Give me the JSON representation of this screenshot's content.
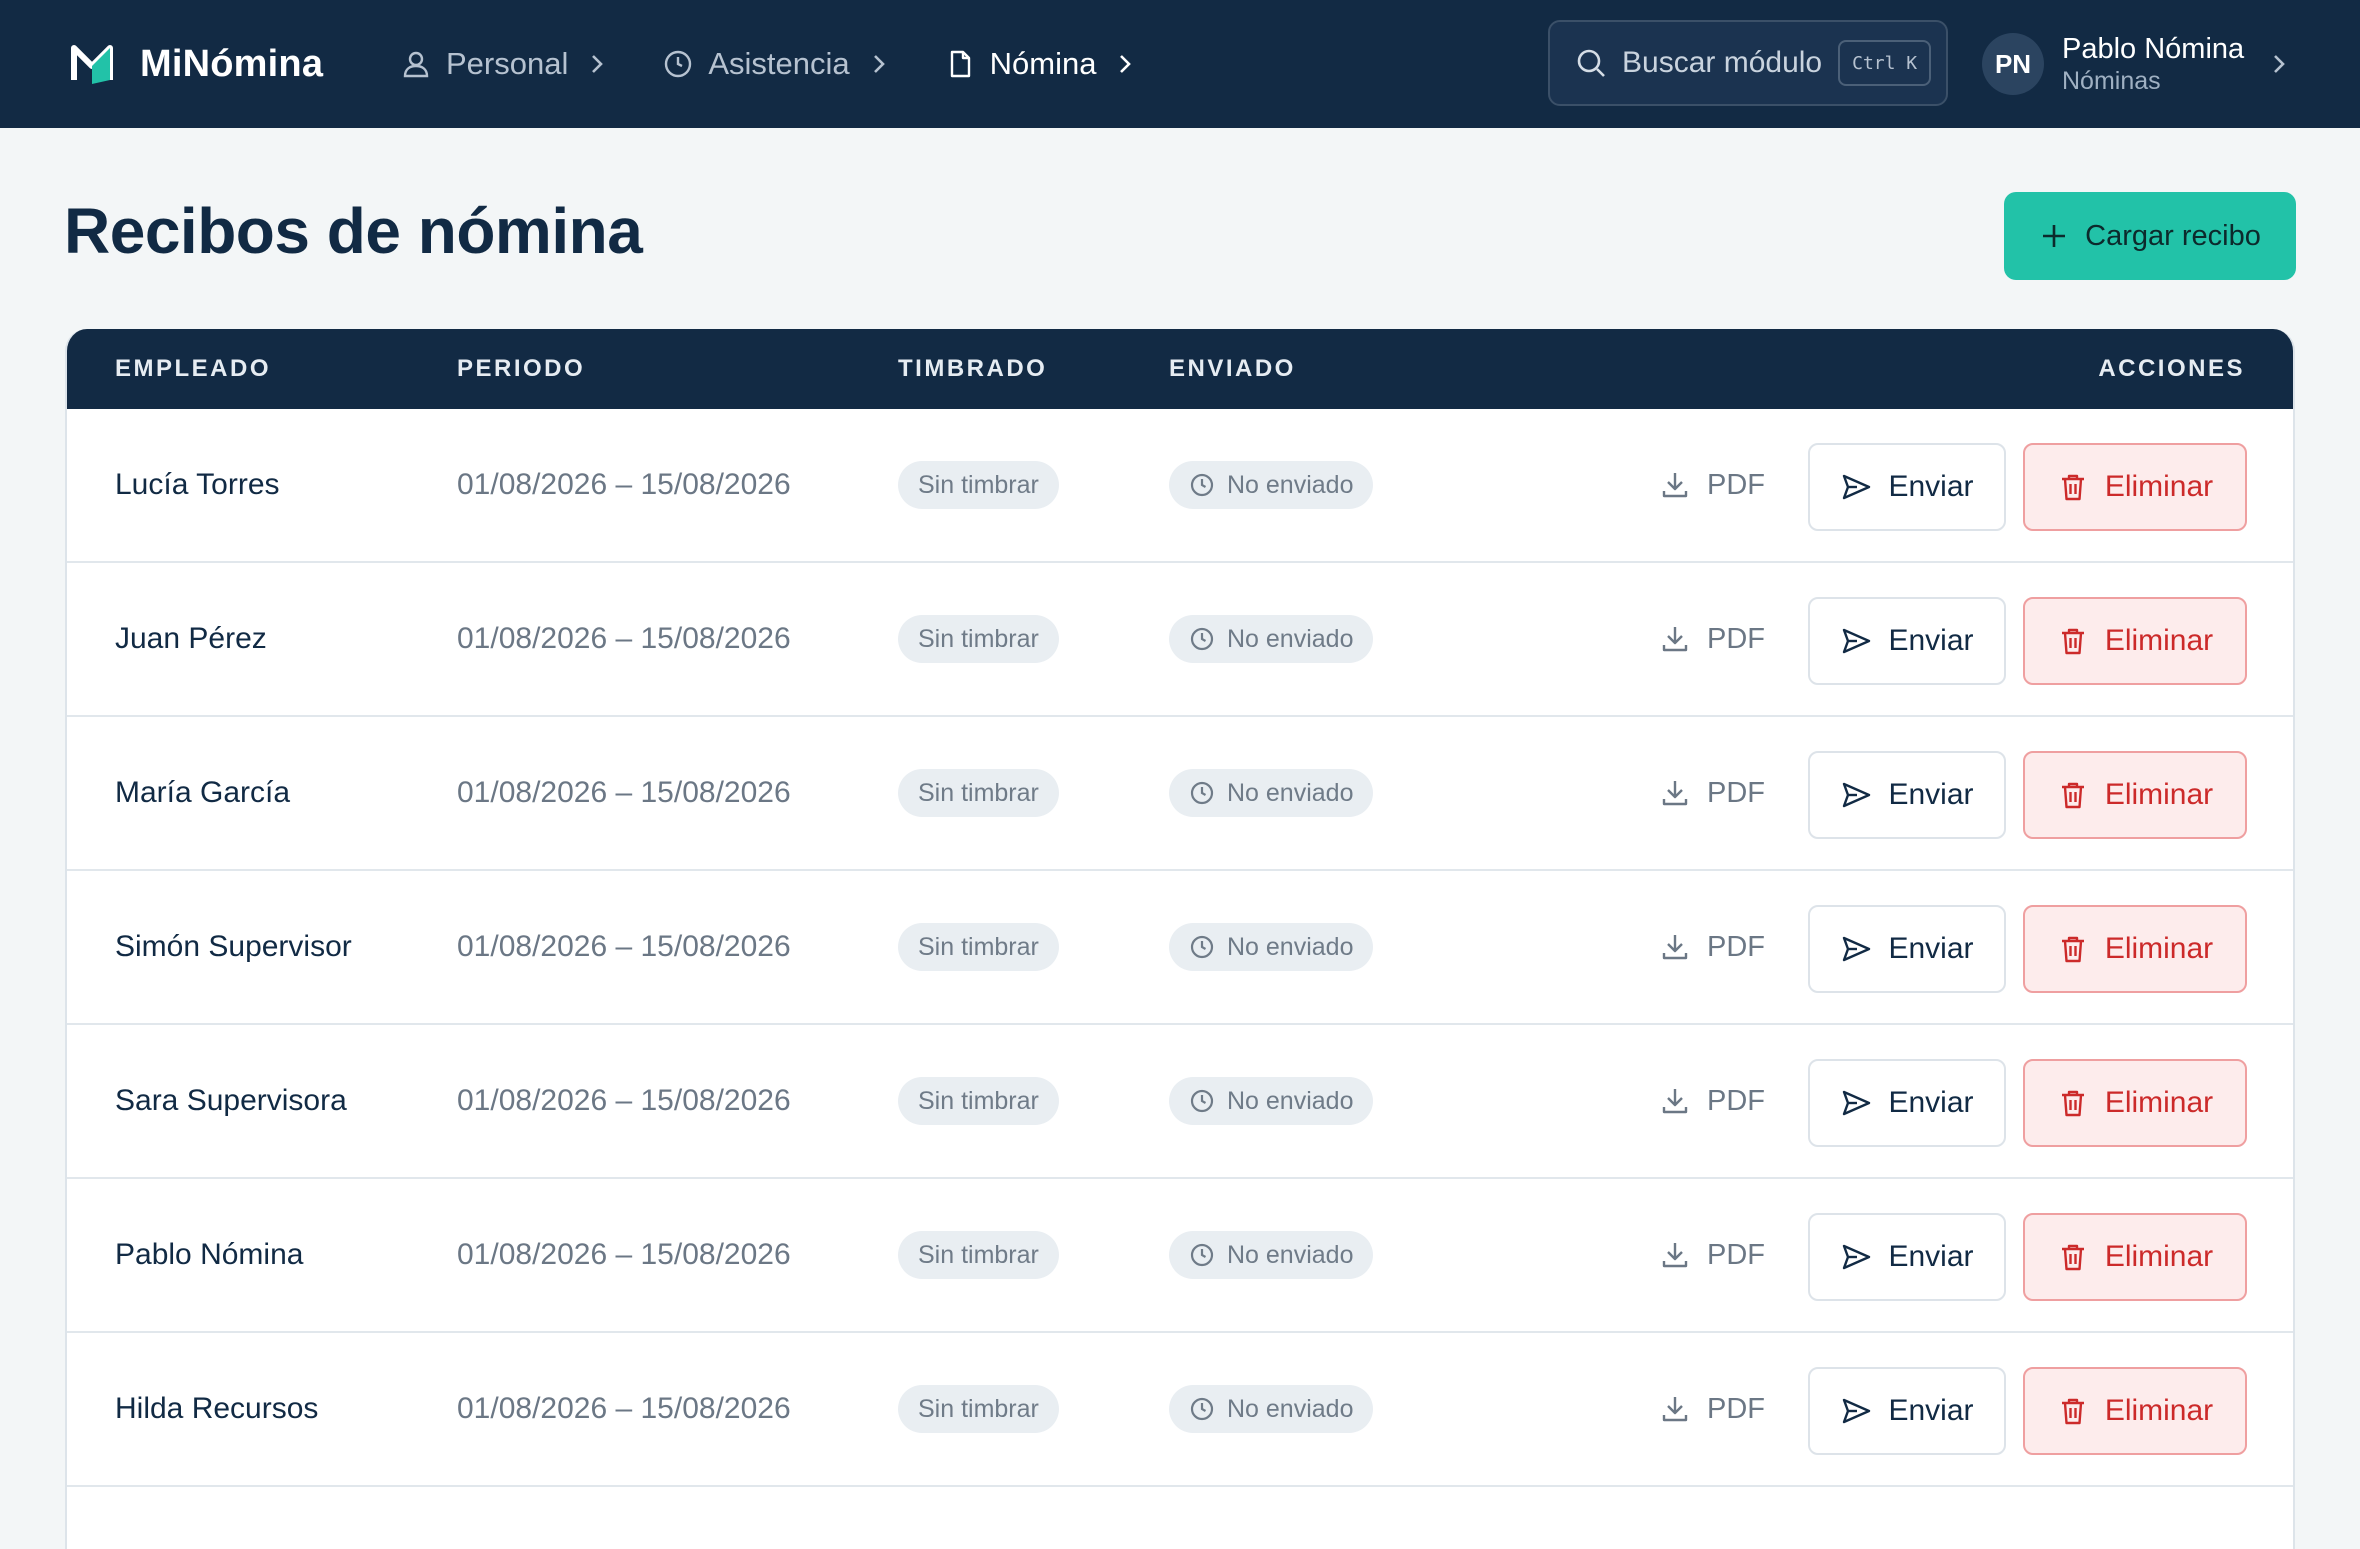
{
  "brand": {
    "name": "MiNómina",
    "accent": "#22c2a8"
  },
  "nav": {
    "items": [
      {
        "label": "Personal",
        "icon": "user-icon"
      },
      {
        "label": "Asistencia",
        "icon": "clock-icon"
      },
      {
        "label": "Nómina",
        "icon": "document-icon",
        "active": true
      }
    ]
  },
  "search": {
    "label": "Buscar módulo",
    "shortcut": "Ctrl K"
  },
  "user": {
    "initials": "PN",
    "name": "Pablo Nómina",
    "role": "Nóminas"
  },
  "page": {
    "title": "Recibos de nómina",
    "primary_action": "Cargar recibo"
  },
  "table": {
    "columns": {
      "empleado": "EMPLEADO",
      "periodo": "PERIODO",
      "timbrado": "TIMBRADO",
      "enviado": "ENVIADO",
      "acciones": "ACCIONES"
    },
    "rows": [
      {
        "empleado": "Lucía Torres",
        "periodo": "01/08/2026 – 15/08/2026",
        "timbrado": "Sin timbrar",
        "enviado": "No enviado",
        "pdf": "PDF",
        "enviar": "Enviar",
        "eliminar": "Eliminar"
      },
      {
        "empleado": "Juan Pérez",
        "periodo": "01/08/2026 – 15/08/2026",
        "timbrado": "Sin timbrar",
        "enviado": "No enviado",
        "pdf": "PDF",
        "enviar": "Enviar",
        "eliminar": "Eliminar"
      },
      {
        "empleado": "María García",
        "periodo": "01/08/2026 – 15/08/2026",
        "timbrado": "Sin timbrar",
        "enviado": "No enviado",
        "pdf": "PDF",
        "enviar": "Enviar",
        "eliminar": "Eliminar"
      },
      {
        "empleado": "Simón Supervisor",
        "periodo": "01/08/2026 – 15/08/2026",
        "timbrado": "Sin timbrar",
        "enviado": "No enviado",
        "pdf": "PDF",
        "enviar": "Enviar",
        "eliminar": "Eliminar"
      },
      {
        "empleado": "Sara Supervisora",
        "periodo": "01/08/2026 – 15/08/2026",
        "timbrado": "Sin timbrar",
        "enviado": "No enviado",
        "pdf": "PDF",
        "enviar": "Enviar",
        "eliminar": "Eliminar"
      },
      {
        "empleado": "Pablo Nómina",
        "periodo": "01/08/2026 – 15/08/2026",
        "timbrado": "Sin timbrar",
        "enviado": "No enviado",
        "pdf": "PDF",
        "enviar": "Enviar",
        "eliminar": "Eliminar"
      },
      {
        "empleado": "Hilda Recursos",
        "periodo": "01/08/2026 – 15/08/2026",
        "timbrado": "Sin timbrar",
        "enviado": "No enviado",
        "pdf": "PDF",
        "enviar": "Enviar",
        "eliminar": "Eliminar"
      }
    ]
  }
}
